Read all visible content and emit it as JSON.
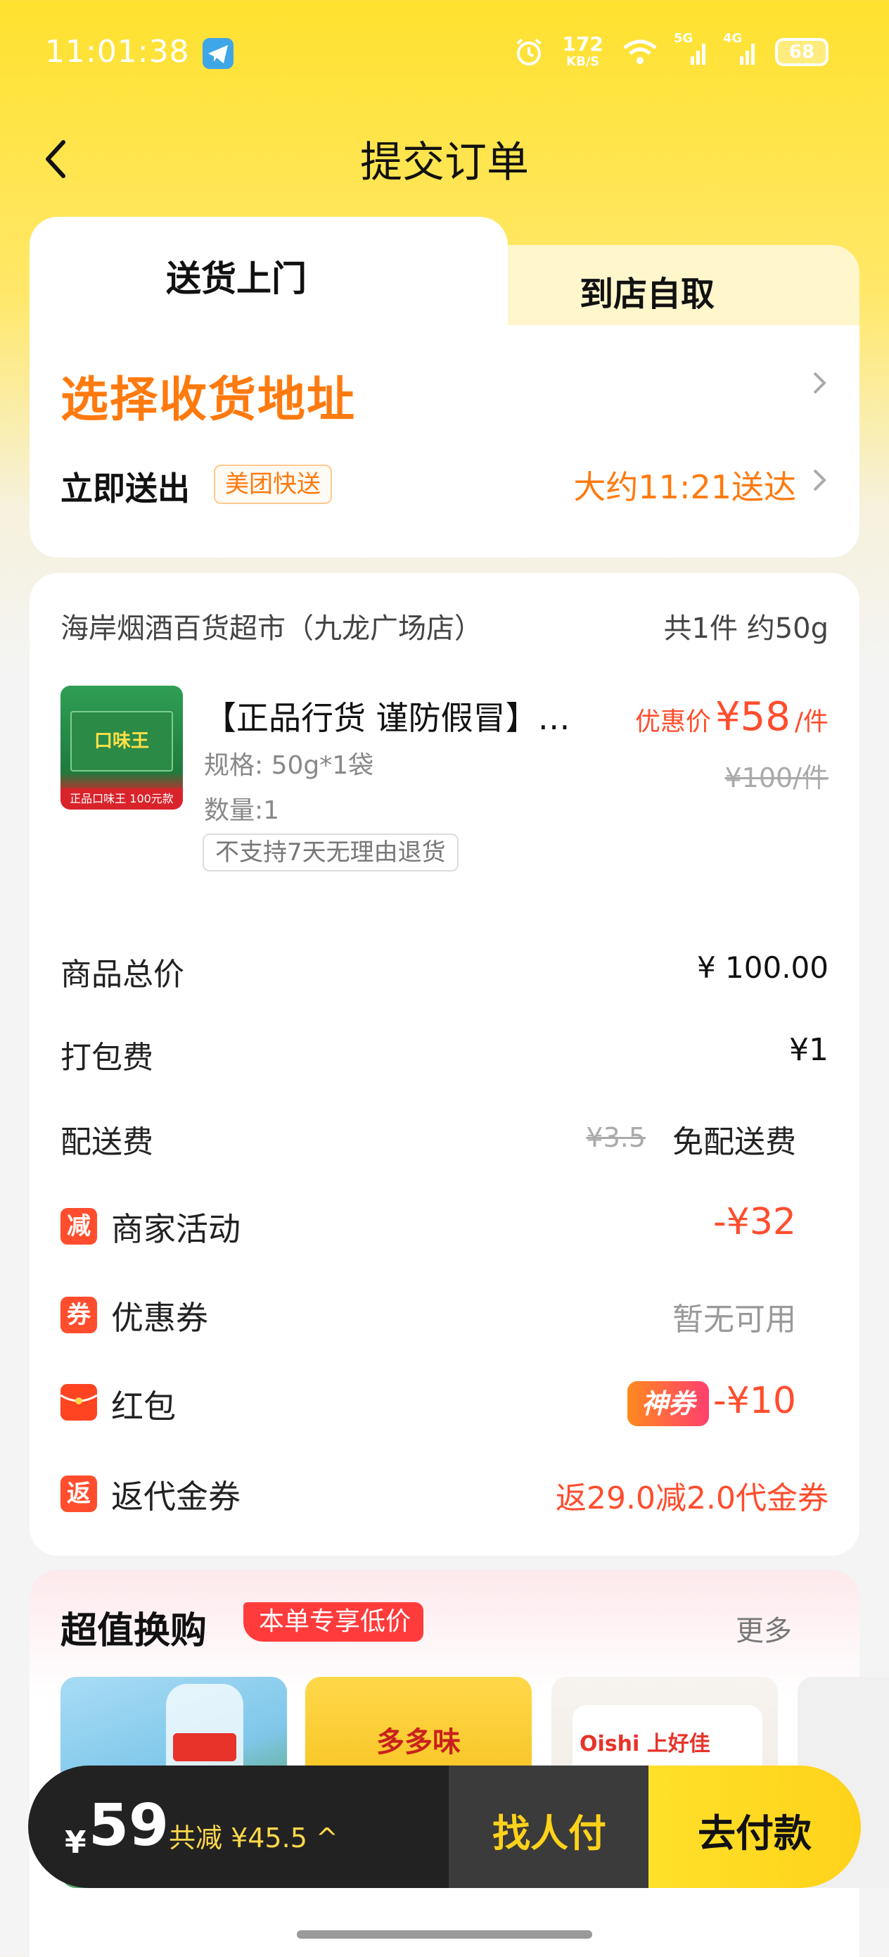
{
  "status_bar": {
    "time": "11:01:38",
    "net_speed_value": "172",
    "net_speed_unit": "KB/S",
    "signal_1": "5G",
    "signal_2": "4G",
    "battery": "68"
  },
  "header": {
    "title": "提交订单"
  },
  "tabs": [
    {
      "label": "送货上门",
      "active": true
    },
    {
      "label": "到店自取",
      "active": false
    }
  ],
  "address": {
    "title": "选择收货地址"
  },
  "delivery": {
    "label": "立即送出",
    "badge": "美团快送",
    "eta": "大约11:21送达"
  },
  "store": {
    "name": "海岸烟酒百货超市（九龙广场店）",
    "summary": "共1件 约50g"
  },
  "product": {
    "name": "【正品行货 谨防假冒】口味王槟榔",
    "spec": "规格: 50g*1袋",
    "qty": "数量:1",
    "tag": "不支持7天无理由退货",
    "price_label": "优惠价",
    "price": "¥58",
    "price_unit": "/件",
    "orig_price": "¥100/件",
    "img_brand": "口味王",
    "img_banner": "正品口味王 100元款"
  },
  "fees": {
    "subtotal_label": "商品总价",
    "subtotal_value": "¥ 100.00",
    "packing_label": "打包费",
    "packing_value": "¥1",
    "delivery_label": "配送费",
    "delivery_orig": "¥3.5",
    "delivery_value": "免配送费"
  },
  "discounts": {
    "promo_icon": "减",
    "promo_label": "商家活动",
    "promo_value": "-¥32",
    "coupon_icon": "券",
    "coupon_label": "优惠券",
    "coupon_value": "暂无可用",
    "redpacket_label": "红包",
    "redpacket_tag": "神券",
    "redpacket_value": "-¥10",
    "rebate_icon": "返",
    "rebate_label": "返代金券",
    "rebate_value": "返29.0减2.0代金券"
  },
  "upsell": {
    "title": "超值换购",
    "tag": "本单专享低价",
    "more": "更多",
    "items": [
      {
        "brand": ""
      },
      {
        "brand": "多多味"
      },
      {
        "brand": "Oishi 上好佳"
      }
    ]
  },
  "bottom_bar": {
    "currency": "¥",
    "total": "59",
    "discount": "共减 ¥45.5 ^",
    "find_pay": "找人付",
    "go_pay": "去付款"
  },
  "colors": {
    "accent": "#ff7a0f",
    "price_red": "#ff4d2d",
    "brand_yellow": "#ffd21a"
  }
}
